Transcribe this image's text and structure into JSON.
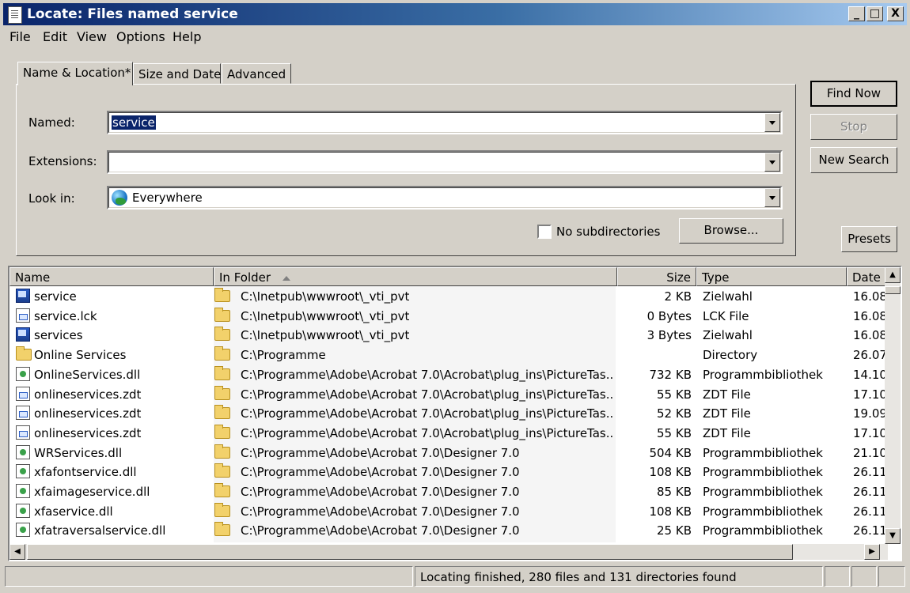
{
  "window": {
    "title": "Locate: Files named service",
    "controls": [
      "_",
      "□",
      "X"
    ]
  },
  "menu": [
    "File",
    "Edit",
    "View",
    "Options",
    "Help"
  ],
  "tabs": [
    "Name & Location*",
    "Size and Date",
    "Advanced"
  ],
  "form": {
    "named_label": "Named:",
    "named_value": "service",
    "extensions_label": "Extensions:",
    "extensions_value": "",
    "lookin_label": "Look in:",
    "lookin_value": "Everywhere",
    "no_subdirs_label": "No subdirectories",
    "no_subdirs_checked": false,
    "browse_label": "Browse..."
  },
  "buttons": {
    "find_now": "Find Now",
    "stop": "Stop",
    "new_search": "New Search",
    "presets": "Presets"
  },
  "columns": [
    "Name",
    "In Folder",
    "Size",
    "Type",
    "Date"
  ],
  "results": [
    {
      "name": "service",
      "icon": "shortcut-icon",
      "folder": "C:\\Inetpub\\wwwroot\\_vti_pvt",
      "size": "2 KB",
      "type": "Zielwahl",
      "date": "16.08"
    },
    {
      "name": "service.lck",
      "icon": "file-icon",
      "folder": "C:\\Inetpub\\wwwroot\\_vti_pvt",
      "size": "0 Bytes",
      "type": "LCK File",
      "date": "16.08"
    },
    {
      "name": "services",
      "icon": "shortcut-icon",
      "folder": "C:\\Inetpub\\wwwroot\\_vti_pvt",
      "size": "3 Bytes",
      "type": "Zielwahl",
      "date": "16.08"
    },
    {
      "name": "Online Services",
      "icon": "folder-icon",
      "folder": "C:\\Programme",
      "size": "",
      "type": "Directory",
      "date": "26.07"
    },
    {
      "name": "OnlineServices.dll",
      "icon": "dll-icon",
      "folder": "C:\\Programme\\Adobe\\Acrobat 7.0\\Acrobat\\plug_ins\\PictureTas...",
      "size": "732 KB",
      "type": "Programmbibliothek",
      "date": "14.10"
    },
    {
      "name": "onlineservices.zdt",
      "icon": "file-icon",
      "folder": "C:\\Programme\\Adobe\\Acrobat 7.0\\Acrobat\\plug_ins\\PictureTas...",
      "size": "55 KB",
      "type": "ZDT File",
      "date": "17.10"
    },
    {
      "name": "onlineservices.zdt",
      "icon": "file-icon",
      "folder": "C:\\Programme\\Adobe\\Acrobat 7.0\\Acrobat\\plug_ins\\PictureTas...",
      "size": "52 KB",
      "type": "ZDT File",
      "date": "19.09"
    },
    {
      "name": "onlineservices.zdt",
      "icon": "file-icon",
      "folder": "C:\\Programme\\Adobe\\Acrobat 7.0\\Acrobat\\plug_ins\\PictureTas...",
      "size": "55 KB",
      "type": "ZDT File",
      "date": "17.10"
    },
    {
      "name": "WRServices.dll",
      "icon": "dll-icon",
      "folder": "C:\\Programme\\Adobe\\Acrobat 7.0\\Designer 7.0",
      "size": "504 KB",
      "type": "Programmbibliothek",
      "date": "21.10"
    },
    {
      "name": "xfafontservice.dll",
      "icon": "dll-icon",
      "folder": "C:\\Programme\\Adobe\\Acrobat 7.0\\Designer 7.0",
      "size": "108 KB",
      "type": "Programmbibliothek",
      "date": "26.11"
    },
    {
      "name": "xfaimageservice.dll",
      "icon": "dll-icon",
      "folder": "C:\\Programme\\Adobe\\Acrobat 7.0\\Designer 7.0",
      "size": "85 KB",
      "type": "Programmbibliothek",
      "date": "26.11"
    },
    {
      "name": "xfaservice.dll",
      "icon": "dll-icon",
      "folder": "C:\\Programme\\Adobe\\Acrobat 7.0\\Designer 7.0",
      "size": "108 KB",
      "type": "Programmbibliothek",
      "date": "26.11"
    },
    {
      "name": "xfatraversalservice.dll",
      "icon": "dll-icon",
      "folder": "C:\\Programme\\Adobe\\Acrobat 7.0\\Designer 7.0",
      "size": "25 KB",
      "type": "Programmbibliothek",
      "date": "26.11"
    }
  ],
  "status": {
    "message": "Locating finished, 280 files and 131 directories found"
  }
}
